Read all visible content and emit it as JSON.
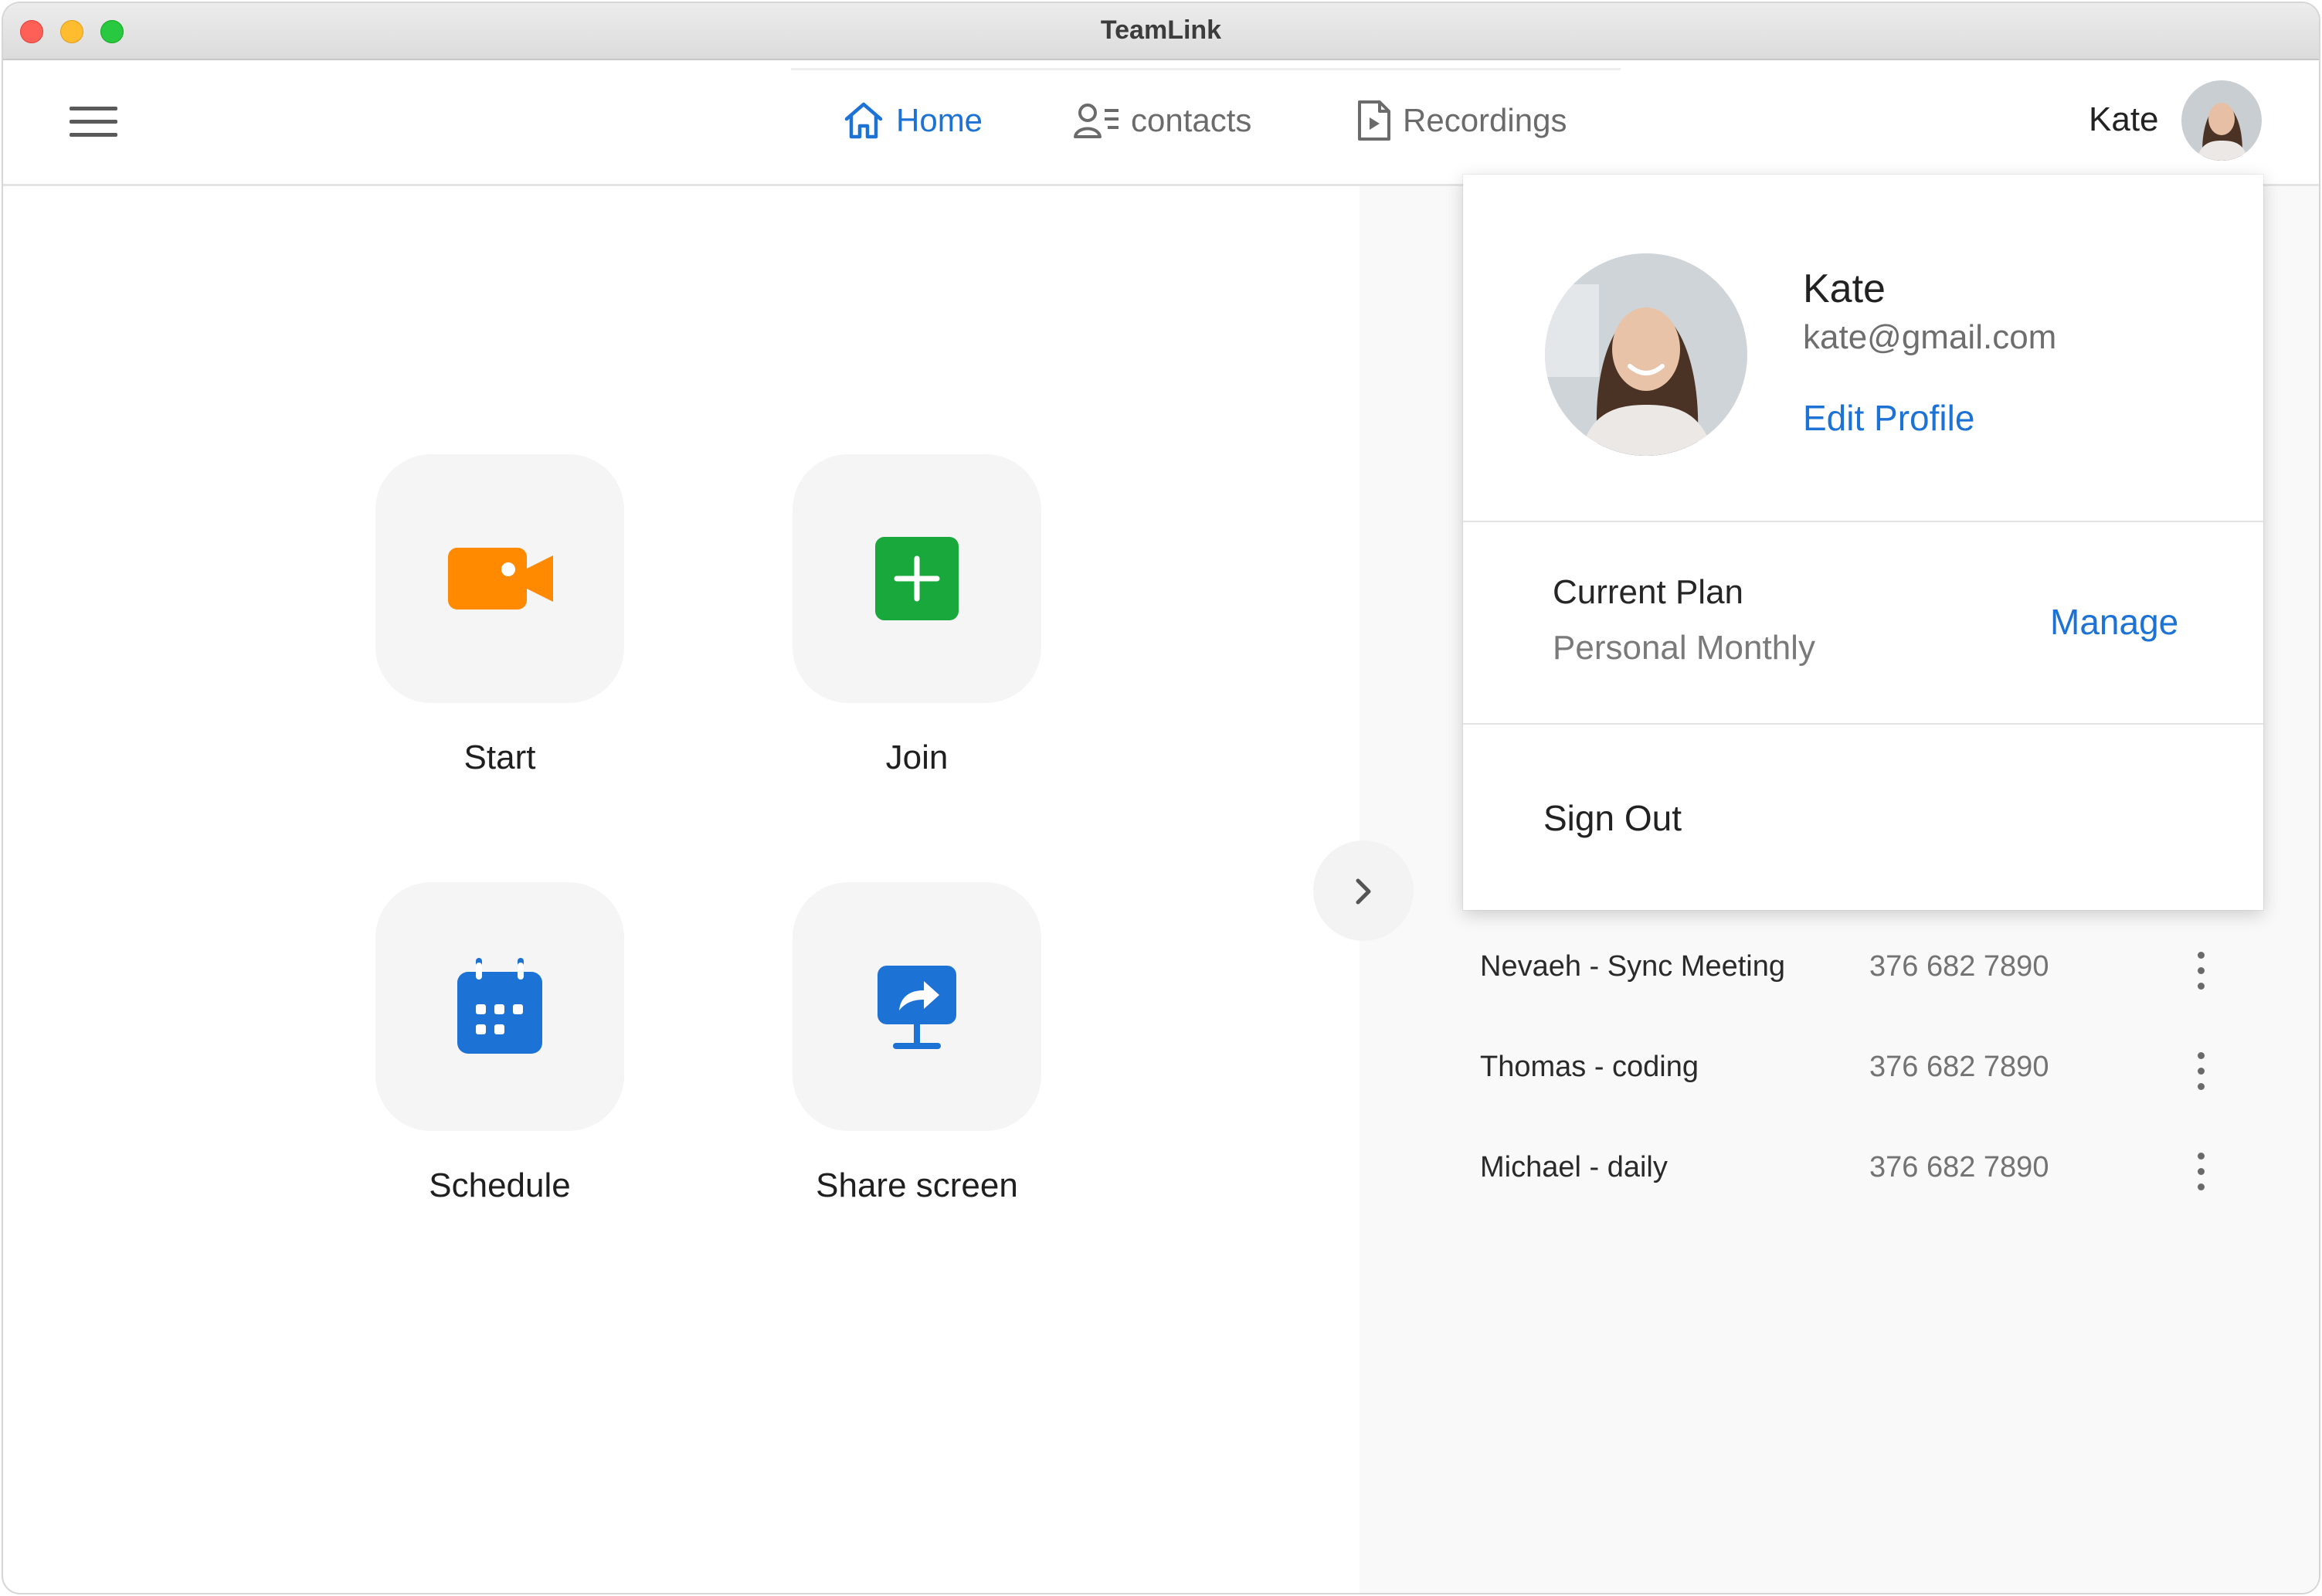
{
  "window": {
    "title": "TeamLink"
  },
  "nav": {
    "tabs": [
      {
        "label": "Home",
        "icon": "home-icon",
        "active": true
      },
      {
        "label": "contacts",
        "icon": "contacts-icon",
        "active": false
      },
      {
        "label": "Recordings",
        "icon": "recordings-icon",
        "active": false
      }
    ]
  },
  "user": {
    "name": "Kate",
    "email": "kate@gmail.com"
  },
  "actions": [
    {
      "label": "Start",
      "icon": "video-camera-icon",
      "color": "#ff8a00"
    },
    {
      "label": "Join",
      "icon": "plus-icon",
      "color": "#19a83c"
    },
    {
      "label": "Schedule",
      "icon": "calendar-icon",
      "color": "#1d72d6"
    },
    {
      "label": "Share screen",
      "icon": "share-screen-icon",
      "color": "#1d72d6"
    }
  ],
  "meetings": [
    {
      "title": "Nevaeh - Sync Meeting",
      "id": "376 682 7890"
    },
    {
      "title": "Thomas - coding",
      "id": "376 682 7890"
    },
    {
      "title": "Michael - daily",
      "id": "376 682 7890"
    }
  ],
  "profile_menu": {
    "name": "Kate",
    "email": "kate@gmail.com",
    "edit_label": "Edit Profile",
    "plan_label": "Current Plan",
    "plan_value": "Personal Monthly",
    "manage_label": "Manage",
    "signout_label": "Sign Out"
  },
  "colors": {
    "accent": "#1d72d6",
    "start": "#ff8a00",
    "join": "#19a83c"
  }
}
